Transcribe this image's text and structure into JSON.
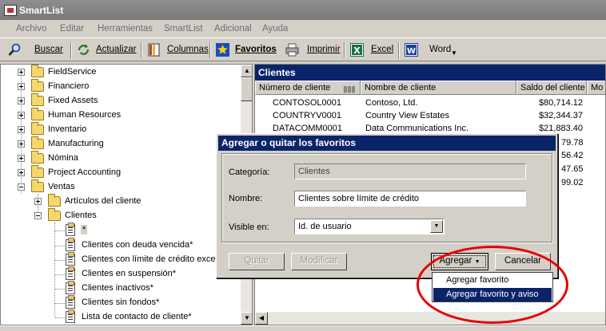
{
  "window": {
    "title": "SmartList"
  },
  "menu": [
    "Archivo",
    "Editar",
    "Herramientas",
    "SmartList",
    "Adicional",
    "Ayuda"
  ],
  "toolbar": {
    "buscar": "Buscar",
    "actualizar": "Actualizar",
    "columnas": "Columnas",
    "favoritos": "Favoritos",
    "imprimir": "Imprimir",
    "excel": "Excel",
    "word": "Word"
  },
  "tree": {
    "items": [
      "FieldService",
      "Financiero",
      "Fixed Assets",
      "Human Resources",
      "Inventario",
      "Manufacturing",
      "Nómina",
      "Project Accounting",
      "Ventas"
    ],
    "ventas_children": [
      "Artículos del cliente",
      "Clientes"
    ],
    "clientes_children": [
      "*",
      "Clientes con deuda vencida*",
      "Clientes con límite de crédito exced",
      "Clientes en suspensión*",
      "Clientes inactivos*",
      "Clientes sin fondos*",
      "Lista de contacto de cliente*"
    ]
  },
  "list": {
    "title": "Clientes",
    "columns": [
      "Número de cliente",
      "Nombre de cliente",
      "Saldo del cliente",
      "Mo"
    ],
    "rows": [
      {
        "num": "CONTOSOL0001",
        "name": "Contoso, Ltd.",
        "saldo": "$80,714.12"
      },
      {
        "num": "COUNTRYV0001",
        "name": "Country View Estates",
        "saldo": "$32,344.37"
      },
      {
        "num": "DATACOMM0001",
        "name": "Data Communications Inc.",
        "saldo": "$21,883.40"
      }
    ],
    "partial_saldos": [
      "79.78",
      "56.42",
      "47.65",
      "99.02"
    ]
  },
  "dialog": {
    "title": "Agregar o quitar los favoritos",
    "categoria_label": "Categoría:",
    "categoria_value": "Clientes",
    "nombre_label": "Nombre:",
    "nombre_value": "Clientes sobre límite de crédito",
    "visible_label": "Visible en:",
    "visible_value": "Id. de usuario",
    "quitar": "Quitar",
    "modificar": "Modificar",
    "agregar": "Agregar",
    "cancelar": "Cancelar"
  },
  "popup": {
    "items": [
      "Agregar favorito",
      "Agregar favorito y aviso"
    ],
    "selected_index": 1
  },
  "colors": {
    "accent": "#0a246a",
    "annotation": "#e80000"
  }
}
